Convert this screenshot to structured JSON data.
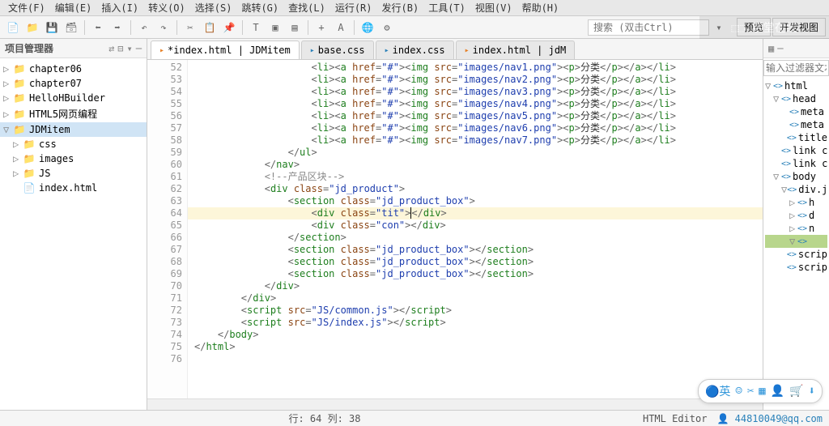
{
  "menu": [
    "文件(F)",
    "编辑(E)",
    "插入(I)",
    "转义(O)",
    "选择(S)",
    "跳转(G)",
    "查找(L)",
    "运行(R)",
    "发行(B)",
    "工具(T)",
    "视图(V)",
    "帮助(H)"
  ],
  "search_placeholder": "搜索 (双击Ctrl)",
  "right_buttons": [
    "预览",
    "开发视图"
  ],
  "project_panel": {
    "title": "项目管理器"
  },
  "tree": [
    {
      "label": "chapter06",
      "type": "folder",
      "level": 0,
      "arrow": "▷"
    },
    {
      "label": "chapter07",
      "type": "folder",
      "level": 0,
      "arrow": "▷"
    },
    {
      "label": "HelloHBuilder",
      "type": "folder",
      "level": 0,
      "arrow": "▷"
    },
    {
      "label": "HTML5网页编程",
      "type": "folder",
      "level": 0,
      "arrow": "▷"
    },
    {
      "label": "JDMitem",
      "type": "folder",
      "level": 0,
      "arrow": "▽",
      "active": true
    },
    {
      "label": "css",
      "type": "folder",
      "level": 1,
      "arrow": "▷"
    },
    {
      "label": "images",
      "type": "folder",
      "level": 1,
      "arrow": "▷"
    },
    {
      "label": "JS",
      "type": "folder",
      "level": 1,
      "arrow": "▷"
    },
    {
      "label": "index.html",
      "type": "html",
      "level": 1,
      "arrow": ""
    }
  ],
  "tabs": [
    {
      "label": "*index.html | JDMitem",
      "icon": "html",
      "active": true
    },
    {
      "label": "base.css",
      "icon": "css"
    },
    {
      "label": "index.css",
      "icon": "css"
    },
    {
      "label": "index.html | jdM",
      "icon": "html"
    }
  ],
  "lines": [
    52,
    53,
    54,
    55,
    56,
    57,
    58,
    59,
    60,
    61,
    62,
    63,
    64,
    65,
    66,
    67,
    68,
    69,
    70,
    71,
    72,
    73,
    74,
    75,
    76
  ],
  "folds": {
    "63": "⊟"
  },
  "status": {
    "pos": "行: 64 列: 38",
    "mode": "HTML Editor",
    "email": "44810049@qq.com"
  },
  "outline_filter": "输入过滤器文本",
  "outline": [
    {
      "label": "html",
      "level": 0,
      "arrow": "▽"
    },
    {
      "label": "head",
      "level": 1,
      "arrow": "▽"
    },
    {
      "label": "meta",
      "level": 2,
      "arrow": ""
    },
    {
      "label": "meta",
      "level": 2,
      "arrow": ""
    },
    {
      "label": "title",
      "level": 2,
      "arrow": ""
    },
    {
      "label": "link c",
      "level": 2,
      "arrow": ""
    },
    {
      "label": "link c",
      "level": 2,
      "arrow": ""
    },
    {
      "label": "body",
      "level": 1,
      "arrow": "▽"
    },
    {
      "label": "div.jc",
      "level": 2,
      "arrow": "▽"
    },
    {
      "label": "h",
      "level": 3,
      "arrow": "▷"
    },
    {
      "label": "d",
      "level": 3,
      "arrow": "▷"
    },
    {
      "label": "n",
      "level": 3,
      "arrow": "▷"
    },
    {
      "label": "",
      "level": 3,
      "arrow": "▽",
      "sel": true
    },
    {
      "label": "scrip",
      "level": 2,
      "arrow": ""
    },
    {
      "label": "scrip",
      "level": 2,
      "arrow": ""
    }
  ],
  "chart_data": null
}
